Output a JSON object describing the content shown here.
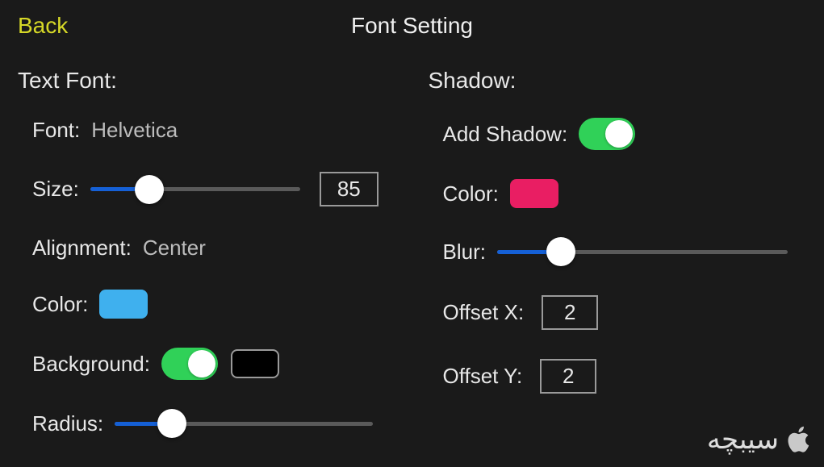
{
  "header": {
    "back_label": "Back",
    "title": "Font Setting"
  },
  "left": {
    "section": "Text Font:",
    "font_label": "Font:",
    "font_value": "Helvetica",
    "size_label": "Size:",
    "size_value": "85",
    "size_slider_percent": 28,
    "alignment_label": "Alignment:",
    "alignment_value": "Center",
    "color_label": "Color:",
    "color_value": "#3fb0ee",
    "background_label": "Background:",
    "background_toggle": true,
    "background_color": "#000000",
    "radius_label": "Radius:",
    "radius_slider_percent": 22
  },
  "right": {
    "section": "Shadow:",
    "add_shadow_label": "Add Shadow:",
    "add_shadow_toggle": true,
    "color_label": "Color:",
    "color_value": "#e91e63",
    "blur_label": "Blur:",
    "blur_slider_percent": 22,
    "offsetx_label": "Offset X:",
    "offsetx_value": "2",
    "offsety_label": "Offset Y:",
    "offsety_value": "2"
  },
  "watermark": "سیبچه"
}
